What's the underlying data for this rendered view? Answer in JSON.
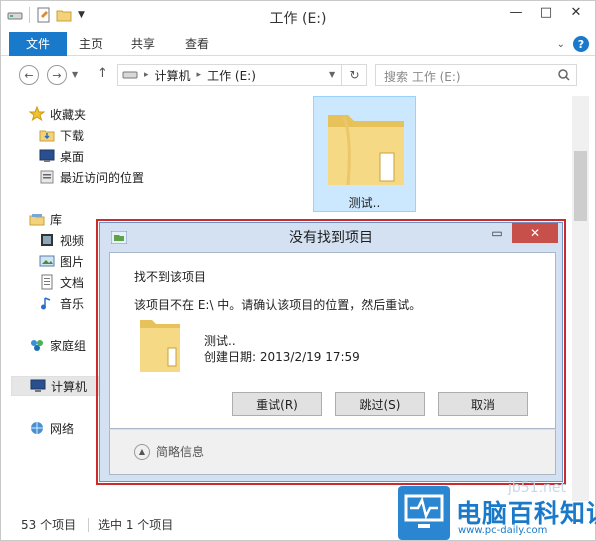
{
  "window": {
    "title": "工作 (E:)"
  },
  "ribbon": {
    "tabs": [
      "文件",
      "主页",
      "共享",
      "查看"
    ]
  },
  "address": {
    "crumbs": [
      "计算机",
      "工作 (E:)"
    ]
  },
  "search": {
    "placeholder": "搜索 工作 (E:)"
  },
  "nav": {
    "favorites_header": "收藏夹",
    "favorites": [
      "下载",
      "桌面",
      "最近访问的位置"
    ],
    "libraries_header": "库",
    "libraries": [
      "视频",
      "图片",
      "文档",
      "音乐"
    ],
    "homegroup": "家庭组",
    "computer": "计算机",
    "network": "网络"
  },
  "content": {
    "folder_name": "测试.."
  },
  "status": {
    "item_count": "53 个项目",
    "selected": "选中 1 个项目"
  },
  "dialog": {
    "title": "没有找到项目",
    "heading": "找不到该项目",
    "message": "该项目不在 E:\\ 中。请确认该项目的位置，然后重试。",
    "item_name": "测试..",
    "item_date": "创建日期: 2013/2/19 17:59",
    "retry": "重试(R)",
    "skip": "跳过(S)",
    "cancel": "取消",
    "details": "简略信息"
  },
  "watermark": {
    "brand": "电脑百科知识",
    "url": "www.pc-daily.com",
    "site": "jb51.net"
  },
  "colors": {
    "accent": "#1979ca",
    "dialog_frame": "#d4e1f2",
    "highlight": "#cc2b2b",
    "folder": "#f3d27a"
  }
}
